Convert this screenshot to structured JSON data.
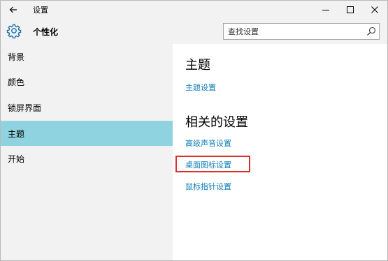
{
  "titlebar": {
    "title": "设置",
    "back_icon": "back-arrow-icon",
    "minimize_icon": "minimize-icon",
    "maximize_icon": "maximize-icon",
    "close_icon": "close-icon"
  },
  "header": {
    "icon": "gear-icon",
    "title": "个性化",
    "search_placeholder": "查找设置",
    "search_icon": "search-icon"
  },
  "sidebar": {
    "items": [
      {
        "label": "背景",
        "active": false
      },
      {
        "label": "颜色",
        "active": false
      },
      {
        "label": "锁屏界面",
        "active": false
      },
      {
        "label": "主题",
        "active": true
      },
      {
        "label": "开始",
        "active": false
      }
    ],
    "active_color": "#8fd3e0"
  },
  "main": {
    "theme_section": {
      "title": "主题",
      "links": [
        "主题设置"
      ]
    },
    "related_section": {
      "title": "相关的设置",
      "links": [
        "高级声音设置",
        "桌面图标设置",
        "鼠标指针设置"
      ]
    },
    "highlighted_link": "桌面图标设置",
    "link_color": "#0f7fb8",
    "highlight_color": "#d8312a"
  }
}
